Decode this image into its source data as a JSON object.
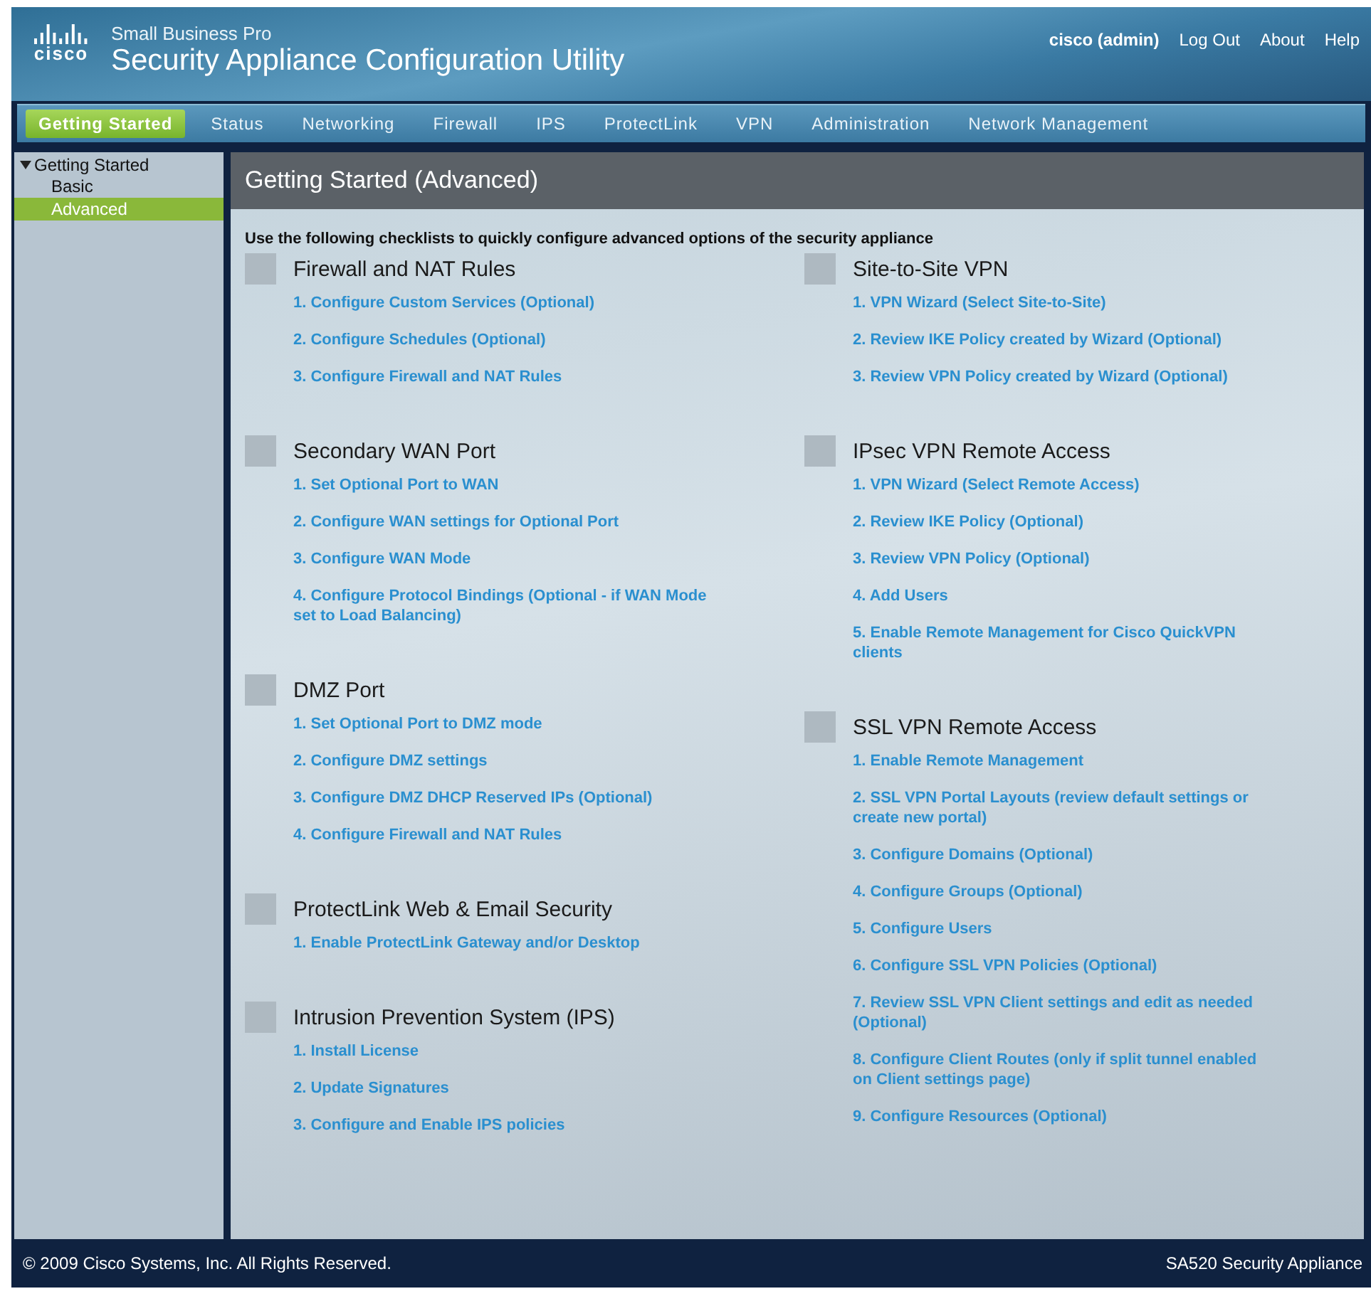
{
  "header": {
    "logo_text": "cisco",
    "product_line": "Small Business Pro",
    "title": "Security Appliance Configuration Utility",
    "user": "cisco (admin)",
    "links": [
      "Log Out",
      "About",
      "Help"
    ]
  },
  "nav": [
    {
      "label": "Getting Started",
      "selected": true
    },
    {
      "label": "Status",
      "selected": false
    },
    {
      "label": "Networking",
      "selected": false
    },
    {
      "label": "Firewall",
      "selected": false
    },
    {
      "label": "IPS",
      "selected": false
    },
    {
      "label": "ProtectLink",
      "selected": false
    },
    {
      "label": "VPN",
      "selected": false
    },
    {
      "label": "Administration",
      "selected": false
    },
    {
      "label": "Network Management",
      "selected": false
    }
  ],
  "sidebar": {
    "items": [
      {
        "label": "Getting Started",
        "expanded": true,
        "children": [
          {
            "label": "Basic",
            "selected": false
          },
          {
            "label": "Advanced",
            "selected": true
          }
        ]
      }
    ]
  },
  "main": {
    "title": "Getting Started (Advanced)",
    "intro": "Use the following checklists to quickly configure advanced options of the security appliance",
    "columns": [
      [
        {
          "heading": "Firewall and NAT Rules",
          "checked": false,
          "links": [
            "1. Configure Custom Services (Optional)",
            "2. Configure Schedules (Optional)",
            "3. Configure Firewall and NAT Rules"
          ]
        },
        {
          "heading": "Secondary WAN Port",
          "checked": false,
          "links": [
            "1. Set Optional Port to WAN",
            "2. Configure WAN settings for Optional Port",
            "3. Configure WAN Mode",
            "4. Configure Protocol Bindings (Optional - if WAN Mode set to Load Balancing)"
          ]
        },
        {
          "heading": "DMZ Port",
          "checked": false,
          "links": [
            "1. Set Optional Port to DMZ mode",
            "2. Configure DMZ settings",
            "3. Configure DMZ DHCP Reserved IPs (Optional)",
            "4. Configure Firewall and NAT Rules"
          ]
        },
        {
          "heading": "ProtectLink Web & Email Security",
          "checked": false,
          "links": [
            "1. Enable ProtectLink Gateway and/or Desktop"
          ]
        },
        {
          "heading": "Intrusion Prevention System (IPS)",
          "checked": false,
          "links": [
            "1. Install License",
            "2. Update Signatures",
            "3. Configure and Enable IPS policies"
          ]
        }
      ],
      [
        {
          "heading": "Site-to-Site VPN",
          "checked": false,
          "links": [
            "1. VPN Wizard (Select Site-to-Site)",
            "2. Review IKE Policy created by Wizard (Optional)",
            "3. Review VPN Policy created by Wizard (Optional)"
          ]
        },
        {
          "heading": "IPsec VPN Remote Access",
          "checked": false,
          "links": [
            "1. VPN Wizard (Select Remote Access)",
            "2. Review IKE Policy (Optional)",
            "3. Review VPN Policy (Optional)",
            "4. Add Users",
            "5. Enable Remote Management for Cisco QuickVPN clients"
          ]
        },
        {
          "heading": "SSL VPN Remote Access",
          "checked": false,
          "links": [
            "1. Enable Remote Management",
            "2. SSL VPN Portal Layouts (review default settings or create new portal)",
            "3. Configure Domains (Optional)",
            "4. Configure Groups (Optional)",
            "5. Configure Users",
            "6. Configure SSL VPN Policies (Optional)",
            "7. Review SSL VPN Client settings and edit as needed (Optional)",
            "8. Configure Client Routes (only if split tunnel enabled on Client settings page)",
            "9. Configure Resources (Optional)"
          ]
        }
      ]
    ]
  },
  "footer": {
    "copyright": "© 2009 Cisco Systems, Inc. All Rights Reserved.",
    "model": "SA520 Security Appliance"
  }
}
